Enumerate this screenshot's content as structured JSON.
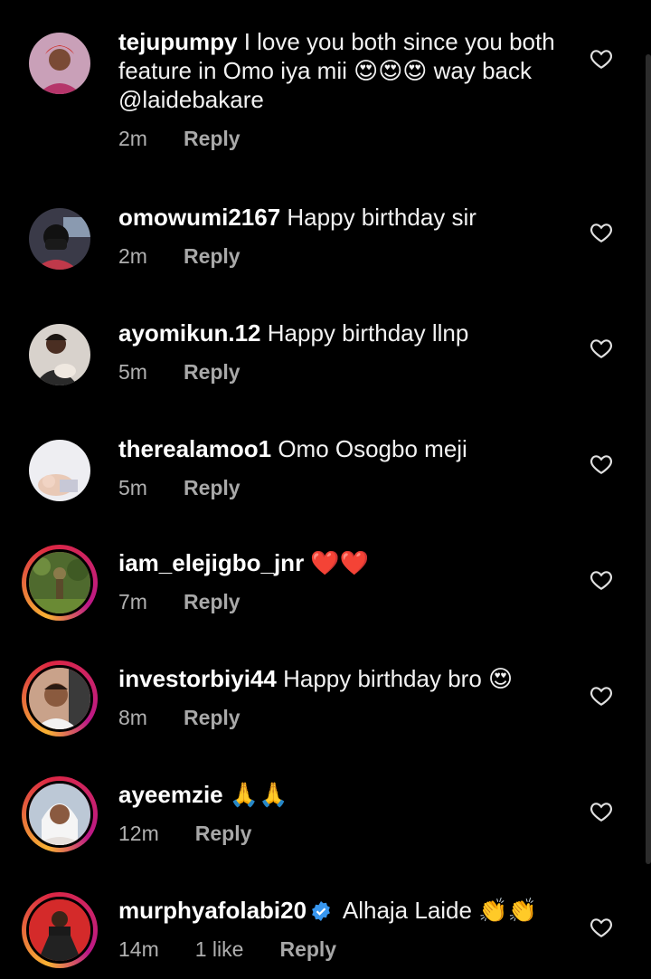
{
  "comments": [
    {
      "username": "tejupumpy",
      "text": "I love you both since you both feature in Omo iya mii 😍😍😍 way back @laidebakare",
      "time": "2m",
      "reply": "Reply",
      "avatar": "woman-red-headwrap"
    },
    {
      "username": "omowumi2167",
      "text": "Happy birthday sir",
      "time": "2m",
      "reply": "Reply",
      "avatar": "person-face-mask"
    },
    {
      "username": "ayomikun.12",
      "text": "Happy birthday llnp",
      "time": "5m",
      "reply": "Reply",
      "avatar": "woman-holding-baby"
    },
    {
      "username": "therealamoo1",
      "text": "Omo Osogbo meji",
      "time": "5m",
      "reply": "Reply",
      "avatar": "baby-photo"
    },
    {
      "username": "iam_elejigbo_jnr",
      "text": "❤️❤️",
      "time": "7m",
      "reply": "Reply",
      "avatar": "figure-in-grass"
    },
    {
      "username": "investorbiyi44",
      "text": "Happy birthday bro 😍",
      "time": "8m",
      "reply": "Reply",
      "avatar": "man-selfie"
    },
    {
      "username": "ayeemzie",
      "text": "🙏🙏",
      "time": "12m",
      "reply": "Reply",
      "avatar": "woman-headscarf"
    },
    {
      "username": "murphyafolabi20",
      "text": "Alhaja Laide 👏👏",
      "time": "14m",
      "likes": "1 like",
      "reply": "Reply",
      "verified": true,
      "avatar": "man-red-background"
    }
  ],
  "colors": {
    "background": "#000000",
    "text": "#f2f2f2",
    "secondary": "#a8a8a8",
    "verified": "#3897f0"
  }
}
